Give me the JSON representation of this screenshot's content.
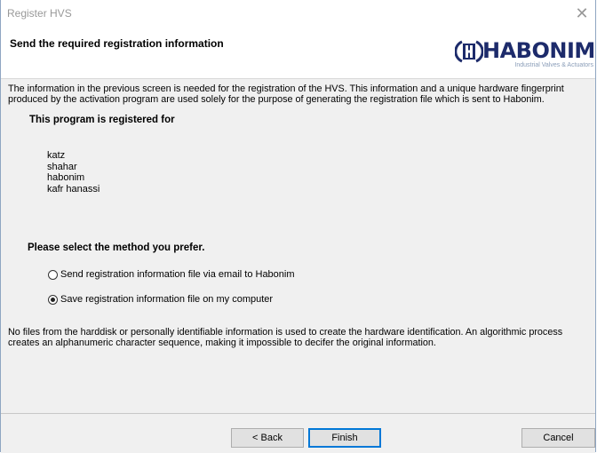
{
  "window": {
    "title": "Register HVS",
    "close_glyph": "✕"
  },
  "header": {
    "title": "Send the required registration information",
    "logo": {
      "name": "HABONIM",
      "tagline": "Industrial Valves & Actuators",
      "color": "#1d2b6b",
      "icon": "habonim-logo-icon"
    }
  },
  "main": {
    "intro": "The information in the previous screen is needed for the registration of the HVS. This information and a unique hardware fingerprint produced by the activation program are used solely for the purpose of generating the registration file which is sent to Habonim.",
    "registered_heading": "This program is registered for",
    "registered_for": [
      "katz",
      "shahar",
      "habonim",
      "kafr hanassi"
    ],
    "method_heading": "Please select the method you prefer.",
    "options": [
      {
        "label": "Send registration information file via email to Habonim",
        "selected": false
      },
      {
        "label": "Save registration information file on my computer",
        "selected": true
      }
    ],
    "privacy_note": "No files from the harddisk or personally identifiable information is used to create the hardware identification.  An algorithmic process creates an alphanumeric character sequence, making it impossible to decifer the original information."
  },
  "footer": {
    "back_label": "< Back",
    "finish_label": "Finish",
    "cancel_label": "Cancel"
  }
}
